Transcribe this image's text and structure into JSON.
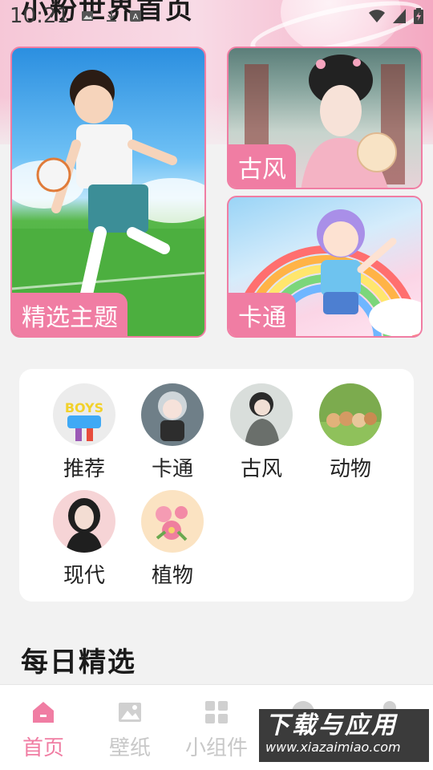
{
  "status_bar": {
    "time": "10:21",
    "icons": [
      "image-icon",
      "download-icon",
      "text-icon",
      "wifi-icon",
      "signal-icon",
      "battery-icon"
    ]
  },
  "header": {
    "title": "小粉世界首页"
  },
  "cards": {
    "featured": {
      "label": "精选主题",
      "image": "boy-soccer-illustration"
    },
    "ancient": {
      "label": "古风",
      "image": "ancient-style-girl-illustration"
    },
    "cartoon": {
      "label": "卡通",
      "image": "cartoon-girl-rainbow-illustration"
    }
  },
  "categories": [
    {
      "label": "推荐",
      "image": "recommend-graffiti-avatar"
    },
    {
      "label": "卡通",
      "image": "cartoon-girl-avatar"
    },
    {
      "label": "古风",
      "image": "ancient-woman-avatar"
    },
    {
      "label": "动物",
      "image": "animals-avatar"
    },
    {
      "label": "现代",
      "image": "modern-woman-avatar"
    },
    {
      "label": "植物",
      "image": "flowers-avatar"
    }
  ],
  "section": {
    "daily_title": "每日精选"
  },
  "bottom_nav": [
    {
      "label": "首页",
      "icon": "home-icon",
      "active": true
    },
    {
      "label": "壁纸",
      "icon": "image-icon",
      "active": false
    },
    {
      "label": "小组件",
      "icon": "grid-icon",
      "active": false
    },
    {
      "label": "",
      "icon": "circle-icon",
      "active": false
    },
    {
      "label": "",
      "icon": "user-icon",
      "active": false
    }
  ],
  "watermark": {
    "title": "下载与应用",
    "url": "www.xiazaimiao.com"
  },
  "colors": {
    "accent": "#f07da3",
    "inactive": "#c8c8c8",
    "background": "#f2f2f2"
  }
}
